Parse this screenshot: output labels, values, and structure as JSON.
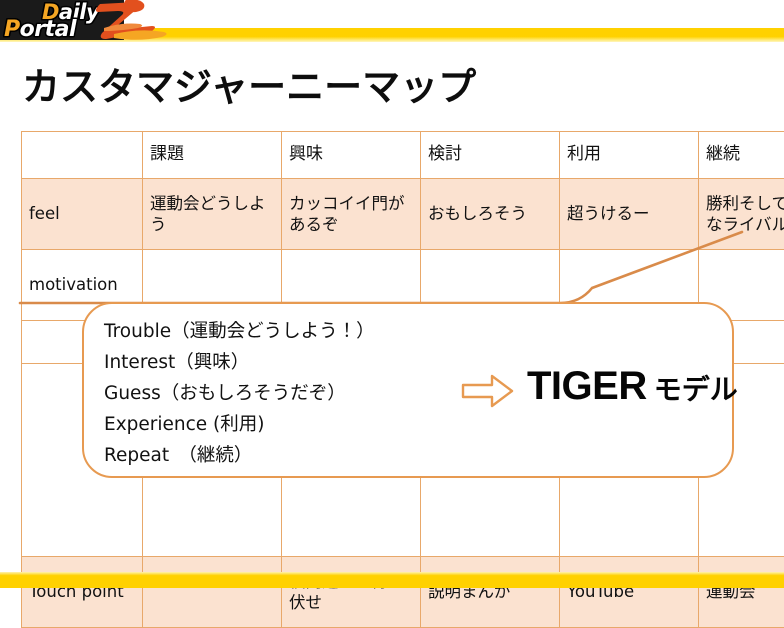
{
  "branding": {
    "logo_line1": "Daily",
    "logo_line2": "Portal",
    "logo_mark": "Z",
    "accent_color": "#F5A623",
    "band_color": "#FFD100"
  },
  "page_title": "カスタマジャーニーマップ",
  "table": {
    "columns": [
      "",
      "課題",
      "興味",
      "検討",
      "利用",
      "継続"
    ],
    "rows": [
      {
        "label": "feel",
        "cells": [
          "運動会どうしよう",
          "カッコイイ門があるぞ",
          "おもしろそう",
          "超うけるー",
          "勝利そして新たなライバル"
        ]
      },
      {
        "label": "motivation",
        "cells": [
          "",
          "",
          "",
          "",
          ""
        ]
      },
      {
        "label": "",
        "cells": [
          "",
          "",
          "",
          "",
          ""
        ]
      },
      {
        "label": "Touch point",
        "cells": [
          "",
          "校門近くで待ち伏せ",
          "説明まんが",
          "YouTube",
          "運動会"
        ]
      }
    ]
  },
  "callout": {
    "lines": [
      "Trouble（運動会どうしよう！）",
      "Interest（興味）",
      "Guess（おもしろそうだぞ）",
      "Experience (利用)",
      "Repeat　（継続）"
    ],
    "arrow": "right-arrow-icon",
    "result_en": "TIGER",
    "result_jp": "モデル",
    "border_color": "#E79A51"
  },
  "colors": {
    "table_border": "#E8A86A",
    "row_highlight": "#FBE2D0",
    "curve": "#D98B4A"
  }
}
